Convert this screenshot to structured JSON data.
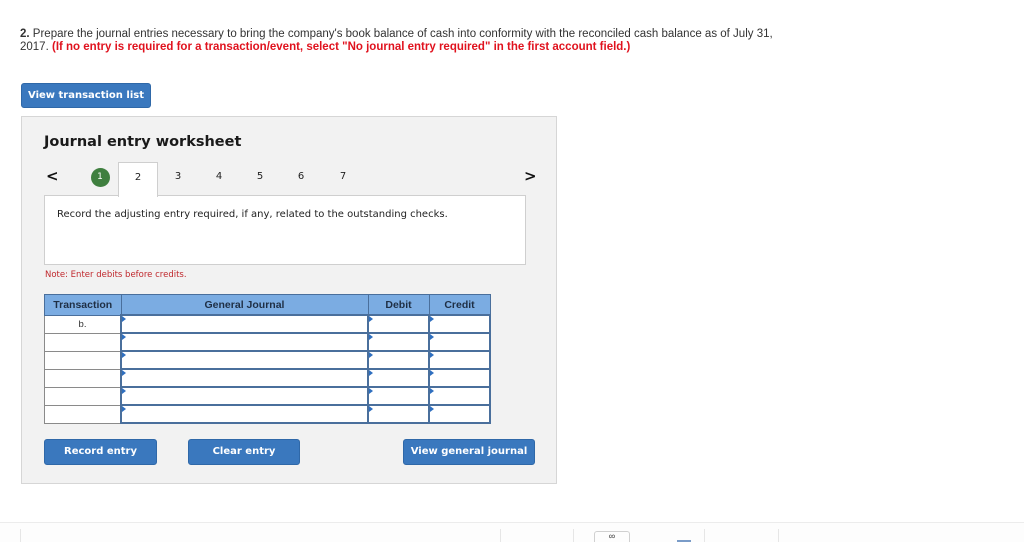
{
  "question": {
    "number": "2.",
    "text": "Prepare the journal entries necessary to bring the company's book balance of cash into conformity with the reconciled cash balance as of July 31, 2017.",
    "instruction": "(If no entry is required for a transaction/event, select \"No journal entry required\" in the first account field.)"
  },
  "buttons": {
    "view_transaction_list": "View transaction list",
    "record_entry": "Record entry",
    "clear_entry": "Clear entry",
    "view_general_journal": "View general journal"
  },
  "worksheet": {
    "title": "Journal entry worksheet",
    "prev_icon": "chevron-left-icon",
    "next_icon": "chevron-right-icon",
    "tabs": [
      {
        "label": "1",
        "state": "completed"
      },
      {
        "label": "2",
        "state": "active"
      },
      {
        "label": "3",
        "state": "default"
      },
      {
        "label": "4",
        "state": "default"
      },
      {
        "label": "5",
        "state": "default"
      },
      {
        "label": "6",
        "state": "default"
      },
      {
        "label": "7",
        "state": "default"
      }
    ],
    "prompt": "Record the adjusting entry required, if any, related to the outstanding checks.",
    "note": "Note: Enter debits before credits.",
    "colors": {
      "header": "#7bace2",
      "completed": "#3f7f3f",
      "button": "#3a78be",
      "note": "#c0282d"
    }
  },
  "journal": {
    "headers": {
      "transaction": "Transaction",
      "general_journal": "General Journal",
      "debit": "Debit",
      "credit": "Credit"
    },
    "rows": [
      {
        "transaction": "b.",
        "account": "",
        "debit": "",
        "credit": ""
      },
      {
        "transaction": "",
        "account": "",
        "debit": "",
        "credit": ""
      },
      {
        "transaction": "",
        "account": "",
        "debit": "",
        "credit": ""
      },
      {
        "transaction": "",
        "account": "",
        "debit": "",
        "credit": ""
      },
      {
        "transaction": "",
        "account": "",
        "debit": "",
        "credit": ""
      },
      {
        "transaction": "",
        "account": "",
        "debit": "",
        "credit": ""
      }
    ]
  },
  "footer": {
    "link_icon": "link-icon"
  }
}
